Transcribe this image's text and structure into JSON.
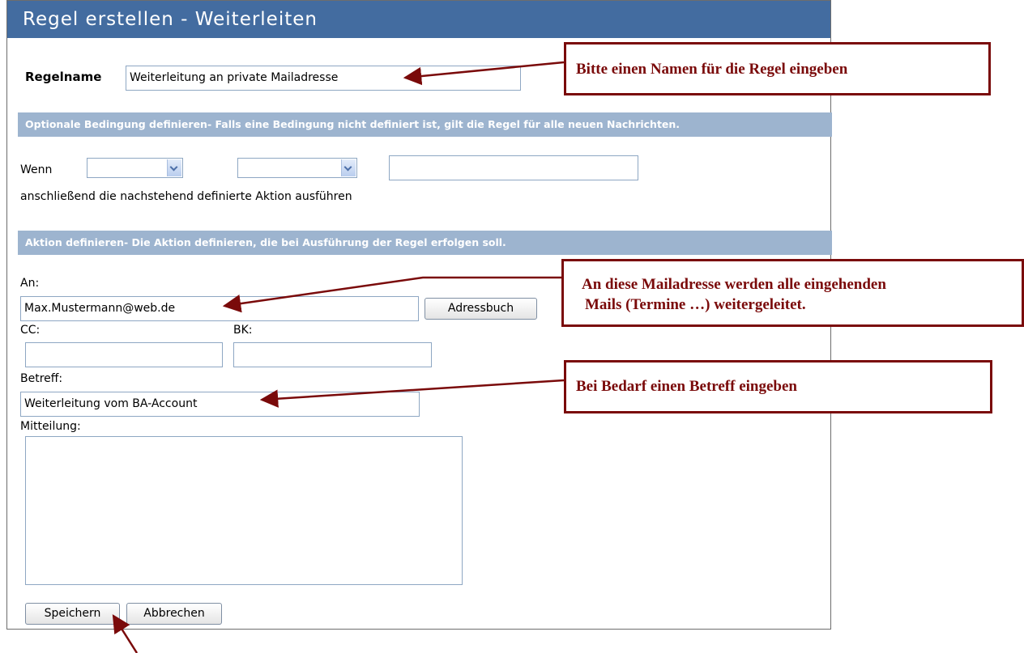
{
  "title": "Regel erstellen - Weiterleiten",
  "rule_name": {
    "label": "Regelname",
    "value": "Weiterleitung an private Mailadresse"
  },
  "condition": {
    "section_label": "Optionale Bedingung definieren- Falls eine Bedingung nicht definiert ist, gilt die Regel für alle neuen Nachrichten.",
    "if_label": "Wenn",
    "select1_value": "",
    "select2_value": "",
    "value_input": "",
    "then_text": "anschließend die nachstehend definierte Aktion ausführen"
  },
  "action": {
    "section_label": "Aktion definieren- Die Aktion definieren, die bei Ausführung der Regel erfolgen soll.",
    "to_label": "An:",
    "to_value": "Max.Mustermann@web.de",
    "address_book_button": "Adressbuch",
    "cc_label": "CC:",
    "cc_value": "",
    "bcc_label": "BK:",
    "bcc_value": "",
    "subject_label": "Betreff:",
    "subject_value": "Weiterleitung vom BA-Account",
    "message_label": "Mitteilung:",
    "message_value": ""
  },
  "buttons": {
    "save": "Speichern",
    "cancel": "Abbrechen"
  },
  "callouts": {
    "name_hint": "Bitte einen Namen für die Regel eingeben",
    "address_hint_line1": "An diese Mailadresse werden alle eingehenden",
    "address_hint_line2": "Mails (Termine …) weitergeleitet.",
    "subject_hint": "Bei Bedarf einen Betreff eingeben"
  },
  "colors": {
    "title_bar": "#436ca0",
    "section_bar": "#9db4cf",
    "callout": "#7a0a0a"
  }
}
